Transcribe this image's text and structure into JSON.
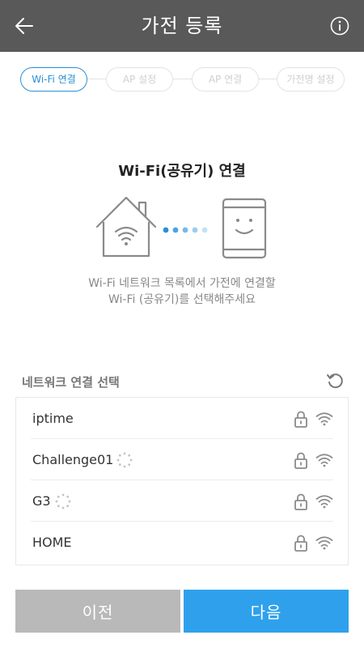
{
  "header": {
    "title": "가전 등록",
    "back_icon": "arrow-left-icon",
    "info_icon": "info-circle-icon"
  },
  "steps": [
    {
      "label": "Wi-Fi 연결",
      "active": true
    },
    {
      "label": "AP 설정",
      "active": false
    },
    {
      "label": "AP 연결",
      "active": false
    },
    {
      "label": "가전명 설정",
      "active": false
    }
  ],
  "main": {
    "title": "Wi-Fi(공유기) 연결",
    "description_line1": "Wi-Fi 네트워크 목록에서 가전에 연결할",
    "description_line2": "Wi-Fi (공유기)를 선택해주세요"
  },
  "network": {
    "label": "네트워크 연결 선택",
    "items": [
      {
        "name": "iptime",
        "loading": false
      },
      {
        "name": "Challenge01",
        "loading": true
      },
      {
        "name": "G3",
        "loading": true
      },
      {
        "name": "HOME",
        "loading": false
      }
    ]
  },
  "buttons": {
    "prev": "이전",
    "next": "다음"
  },
  "colors": {
    "header_bg": "#595959",
    "accent": "#2b8fd8",
    "next_button": "#2fa1ec",
    "prev_button": "#b9b9b9"
  }
}
